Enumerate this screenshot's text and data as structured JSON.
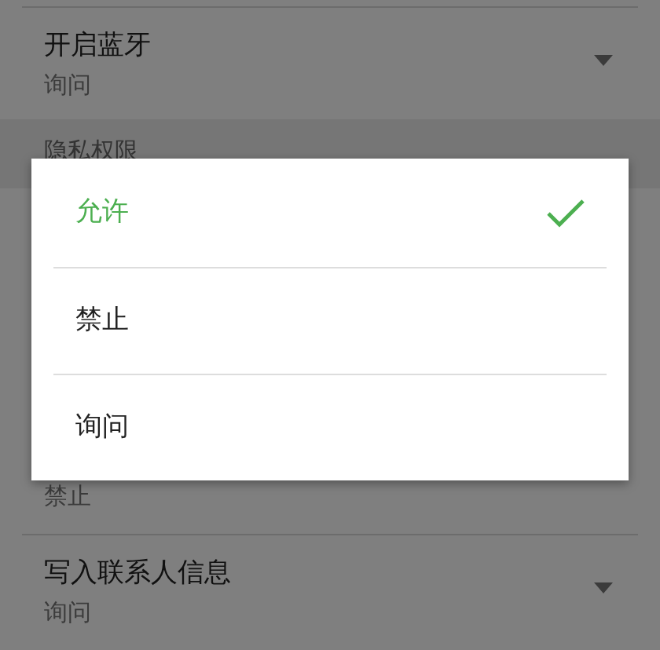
{
  "settings": [
    {
      "kind": "row",
      "title": "开启蓝牙",
      "value": "询问"
    },
    {
      "kind": "header",
      "title": "隐私权限"
    },
    {
      "kind": "partial",
      "value": "禁止"
    },
    {
      "kind": "row",
      "title": "写入联系人信息",
      "value": "询问"
    }
  ],
  "dialog": {
    "options": [
      {
        "label": "允许",
        "selected": true
      },
      {
        "label": "禁止",
        "selected": false
      },
      {
        "label": "询问",
        "selected": false
      }
    ]
  }
}
